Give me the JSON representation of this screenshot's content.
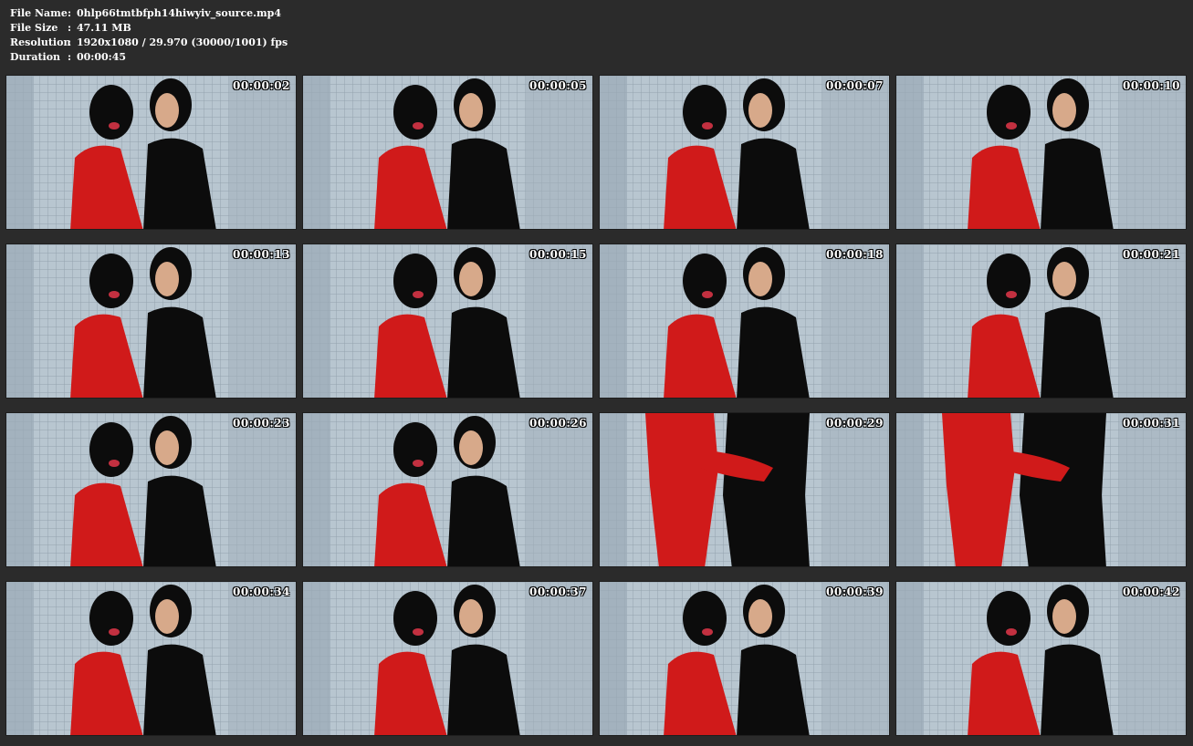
{
  "info": [
    {
      "label": "File Name",
      "sep": ":",
      "value": "0hlp66tmtbfph14hiwyiv_source.mp4"
    },
    {
      "label": "File Size",
      "sep": ":",
      "value": "47.11 MB"
    },
    {
      "label": "Resolution",
      "sep": ":",
      "value": "1920x1080 / 29.970 (30000/1001) fps"
    },
    {
      "label": "Duration",
      "sep": ":",
      "value": "00:00:45"
    }
  ],
  "thumbnails": [
    {
      "time": "00:00:02"
    },
    {
      "time": "00:00:05"
    },
    {
      "time": "00:00:07"
    },
    {
      "time": "00:00:10"
    },
    {
      "time": "00:00:13"
    },
    {
      "time": "00:00:15"
    },
    {
      "time": "00:00:18"
    },
    {
      "time": "00:00:21"
    },
    {
      "time": "00:00:23"
    },
    {
      "time": "00:00:26"
    },
    {
      "time": "00:00:29"
    },
    {
      "time": "00:00:31"
    },
    {
      "time": "00:00:34"
    },
    {
      "time": "00:00:37"
    },
    {
      "time": "00:00:39"
    },
    {
      "time": "00:00:42"
    }
  ],
  "colors": {
    "background": "#2b2b2b",
    "tile_wall": "#a9b7c2",
    "red_suit": "#d01a1a",
    "black_suit": "#0c0c0c"
  }
}
